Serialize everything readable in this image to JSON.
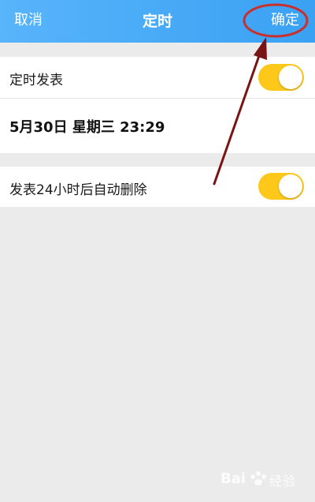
{
  "navbar": {
    "cancel_label": "取消",
    "title": "定时",
    "confirm_label": "确定",
    "background_color": "#4aa9f7"
  },
  "schedule": {
    "label": "定时发表",
    "toggle_on": true,
    "datetime": "5月30日 星期三 23:29"
  },
  "auto_delete": {
    "label": "发表24小时后自动删除",
    "toggle_on": true
  },
  "toggle_color": "#fec81b",
  "annotation_color": "#8b1a1a",
  "watermark": {
    "brand": "Bai",
    "suffix": "经验"
  }
}
